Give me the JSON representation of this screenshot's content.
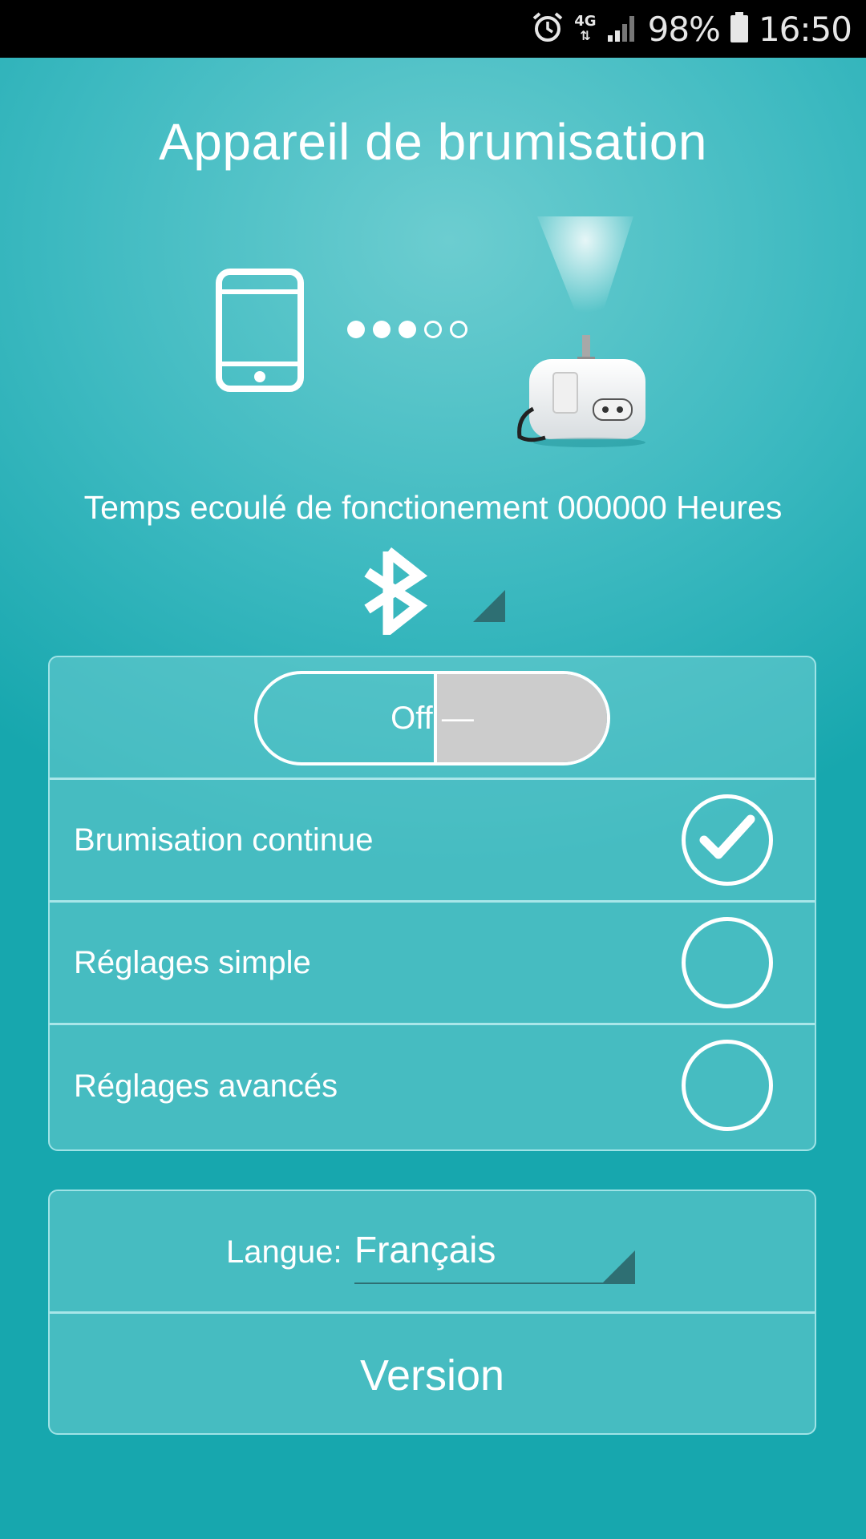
{
  "status_bar": {
    "network": "4G",
    "battery": "98%",
    "time": "16:50",
    "icons": [
      "alarm-icon",
      "network-icon",
      "signal-icon",
      "battery-icon"
    ]
  },
  "header": {
    "title": "Appareil de brumisation"
  },
  "connection": {
    "dots_filled": 3,
    "dots_total": 5,
    "icons": [
      "phone-icon",
      "misting-device-image",
      "bluetooth-icon"
    ]
  },
  "runtime_text": "Temps ecoulé de fonctionement 000000 Heures",
  "power_toggle": {
    "label": "Off —",
    "state": "off"
  },
  "modes": {
    "items": [
      {
        "label": "Brumisation continue",
        "selected": true
      },
      {
        "label": "Réglages simple",
        "selected": false
      },
      {
        "label": "Réglages avancés",
        "selected": false
      }
    ]
  },
  "settings": {
    "language_label": "Langue:",
    "language_value": "Français",
    "version_label": "Version"
  },
  "colors": {
    "background_center": "#6ccdd0",
    "background_edge": "#17a7ae",
    "panel_border": "#9fe3e6",
    "toggle_thumb": "#cccccc",
    "accent_dark": "#2e6f73"
  }
}
